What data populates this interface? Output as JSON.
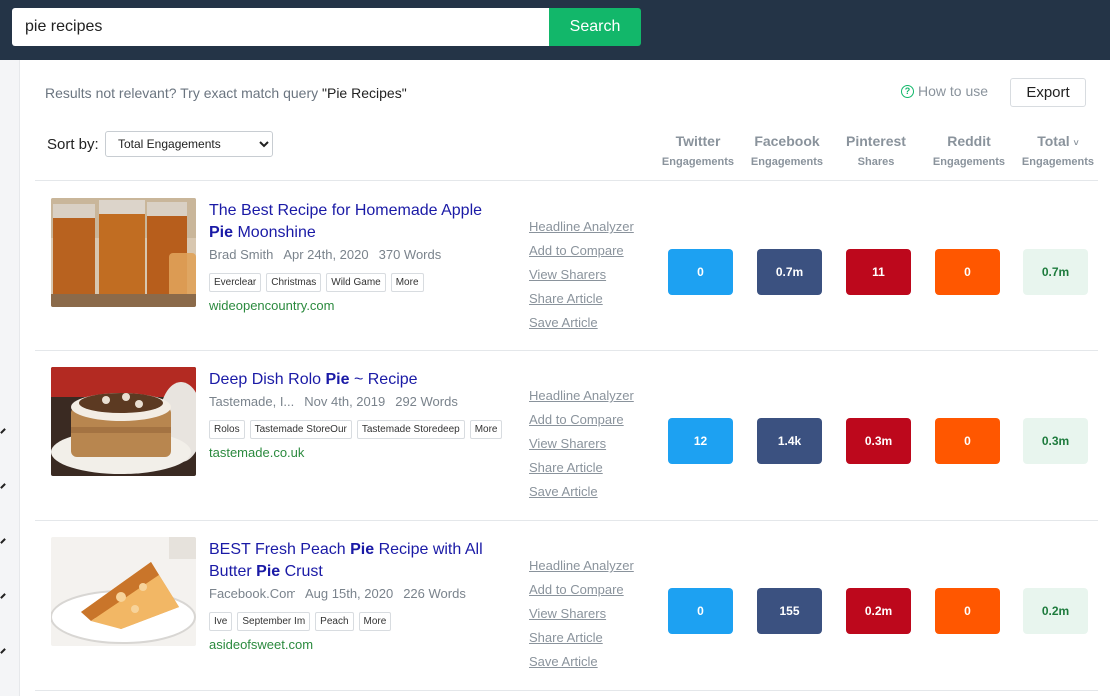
{
  "search": {
    "value": "pie recipes",
    "button_label": "Search"
  },
  "hint": {
    "prefix": "Results not relevant? Try exact match query ",
    "query": "\"Pie Recipes\""
  },
  "how_to_use": "How to use",
  "how_to_use_icon": "?",
  "export_label": "Export",
  "sort": {
    "label": "Sort by:",
    "selected": "Total Engagements"
  },
  "columns": [
    {
      "main": "Twitter",
      "sub": "Engagements"
    },
    {
      "main": "Facebook",
      "sub": "Engagements"
    },
    {
      "main": "Pinterest",
      "sub": "Shares"
    },
    {
      "main": "Reddit",
      "sub": "Engagements"
    },
    {
      "main": "Total",
      "sub": "Engagements",
      "chevron": "˅"
    }
  ],
  "actions": [
    "Headline Analyzer",
    "Add to Compare",
    "View Sharers",
    "Share Article",
    "Save Article"
  ],
  "articles": [
    {
      "title_parts": [
        "The Best Recipe for Homemade Apple ",
        "Pie",
        " Moonshine"
      ],
      "author": "Brad Smith",
      "date": "Apr 24th, 2020",
      "words": "370 Words",
      "tags": [
        "Everclear",
        "Christmas",
        "Wild Game",
        "More"
      ],
      "domain": "wideopencountry.com",
      "twitter": "0",
      "facebook": "0.7m",
      "pinterest": "11",
      "reddit": "0",
      "total": "0.7m"
    },
    {
      "title_parts": [
        "Deep Dish Rolo ",
        "Pie",
        " ~ Recipe"
      ],
      "author": "Tastemade, I...",
      "date": "Nov 4th, 2019",
      "words": "292 Words",
      "tags": [
        "Rolos",
        "Tastemade StoreOur",
        "Tastemade Storedeep",
        "More"
      ],
      "domain": "tastemade.co.uk",
      "twitter": "12",
      "facebook": "1.4k",
      "pinterest": "0.3m",
      "reddit": "0",
      "total": "0.3m"
    },
    {
      "title_parts": [
        "BEST Fresh Peach ",
        "Pie",
        " Recipe with All Butter ",
        "Pie",
        " Crust"
      ],
      "author": "Facebook.Com...",
      "date": "Aug 15th, 2020",
      "words": "226 Words",
      "tags": [
        "Ive",
        "September Im",
        "Peach",
        "More"
      ],
      "domain": "asideofsweet.com",
      "twitter": "0",
      "facebook": "155",
      "pinterest": "0.2m",
      "reddit": "0",
      "total": "0.2m"
    }
  ],
  "colors": {
    "topbar": "#243447",
    "search_button": "#12b76a",
    "title_link": "#1a1aa6",
    "domain": "#2b8a3e",
    "twitter": "#1da1f2",
    "facebook": "#3b5180",
    "pinterest": "#bd081c",
    "reddit": "#ff5700",
    "total_bg": "#e8f5ee"
  }
}
